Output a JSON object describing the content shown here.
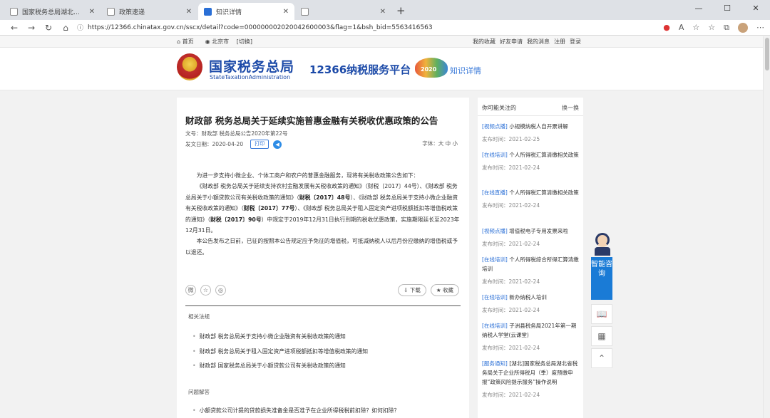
{
  "browser": {
    "tabs": [
      {
        "title": "国家税务总局湖北省电子税务局",
        "active": false
      },
      {
        "title": "政策速递",
        "active": false
      },
      {
        "title": "知识详情",
        "active": true
      },
      {
        "title": "",
        "active": false
      }
    ],
    "new_tab": "+",
    "window_controls": [
      "—",
      "☐",
      "✕"
    ],
    "url": "https://12366.chinatax.gov.cn/sscx/detail?code=000000002020042600003&flag=1&bsh_bid=5563416563"
  },
  "topnav": {
    "home": "首页",
    "location": "北京市",
    "switch": "[切换]",
    "links": [
      "我的收藏",
      "好友申请",
      "我的消息",
      "注册",
      "登录"
    ]
  },
  "header": {
    "brand_cn": "国家税务总局",
    "brand_en": "StateTaxationAdministration",
    "platform": "12366纳税服务平台",
    "mascot_text": "2020",
    "subtitle": "知识详情"
  },
  "article": {
    "title": "财政部 税务总局关于延续实施普惠金融有关税收优惠政策的公告",
    "doc_no_label": "文号：",
    "doc_no": "财政部 税务总局公告2020年第22号",
    "date_label": "发文日期：",
    "date": "2020-04-20",
    "print_label": "打印",
    "font_size_label": "字体：",
    "font_sizes": "大 中 小",
    "para1_a": "为进一步支持小微企业、个体工商户和农户的普惠金融服务，现将有关税收政策公告如下：",
    "para2_a": "《财政部 税务总局关于延续支持农村金融发展有关税收政策的通知》（财税〔2017〕44号）、《财政部 税务总局关于小额贷款公司有关税收政策的通知》（",
    "para2_b": "财税〔2017〕48号",
    "para2_c": "）、《财政部 税务总局关于支持小微企业融资有关税收政策的通知》（",
    "para2_d": "财税〔2017〕77号",
    "para2_e": "）、《财政部 税务总局关于租入固定资产进项税额抵扣等增值税政策的通知》（",
    "para2_f": "财税〔2017〕90号",
    "para2_g": "）中规定于2019年12月31日执行到期的税收优惠政策，实施期限延长至2023年12月31日。",
    "para3": "本公告发布之日前，已征的按照本公告规定应予免征的增值税，可抵减纳税人以后月份应缴纳的增值税或予以退还。",
    "share_icons": [
      "微",
      "☆",
      "◎"
    ],
    "download_label": "下载",
    "favorite_label": "收藏",
    "related_label": "相关法规",
    "related": [
      "财政部 税务总局关于支持小微企业融资有关税收政策的通知",
      "财政部 税务总局关于租入固定资产进项税额抵扣等增值税政策的通知",
      "财政部 国家税务总局关于小额贷款公司有关税收政策的通知"
    ],
    "qa_label": "问题解答",
    "qa": [
      "小额贷款公司计提的贷款损失准备金是否准予在企业所得税税前扣除？如何扣除？"
    ]
  },
  "sidebar": {
    "title": "你可能关注的",
    "refresh": "换一换",
    "items": [
      {
        "tag": "[视频点播]",
        "text": " 小规模纳税人自开票讲解",
        "date": "发布时间：2021-02-25"
      },
      {
        "tag": "[在线培训]",
        "text": " 个人所得税汇算清缴相关政策",
        "date": "发布时间：2021-02-24"
      },
      {
        "tag": "[在线直播]",
        "text": " 个人所得税汇算清缴相关政策",
        "date": "发布时间：2021-02-24"
      },
      {
        "tag": "[视频点播]",
        "text": " 增值税电子专用发票来啦",
        "date": "发布时间：2021-02-24"
      },
      {
        "tag": "[在线培训]",
        "text": " 个人所得税综合所得汇算清缴培训",
        "date": "发布时间：2021-02-24"
      },
      {
        "tag": "[在线培训]",
        "text": " 新办纳税人培训",
        "date": "发布时间：2021-02-24"
      },
      {
        "tag": "[在线培训]",
        "text": " 子洲县税务局2021年第一期纳税人学堂(云课堂)",
        "date": "发布时间：2021-02-24"
      },
      {
        "tag": "[服务通知]",
        "text": " [湖北]国家税务总局湖北省税务局关于企业所得税月（季）度预缴申报“政策风险提示服务”操作说明",
        "date": "发布时间：2021-02-24"
      }
    ]
  },
  "float": {
    "consult": "智能咨询",
    "book_icon": "📖",
    "qr_icon": "▦",
    "top_icon": "⌃"
  }
}
